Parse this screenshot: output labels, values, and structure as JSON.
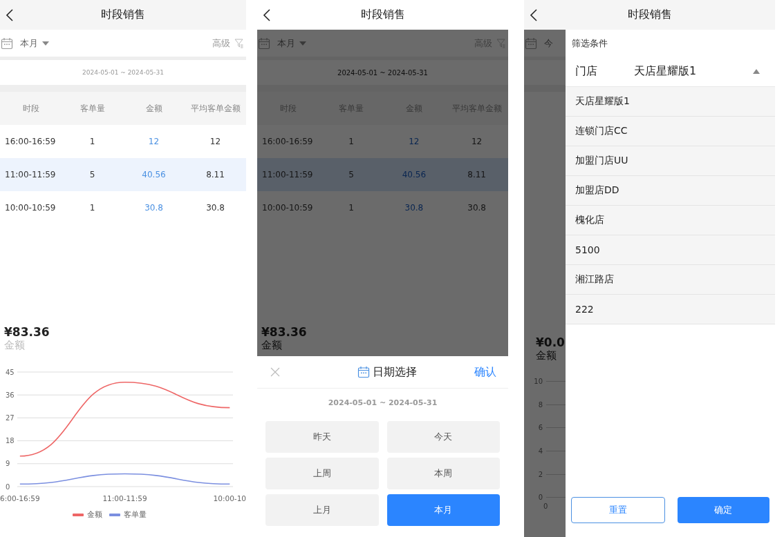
{
  "screens": [
    {
      "kind": "report",
      "title": "时段销售",
      "period": "本月",
      "advanced": "高级",
      "date_range": "2024-05-01 ~ 2024-05-31",
      "table": {
        "columns": [
          "时段",
          "客单量",
          "金额",
          "平均客单金额"
        ],
        "rows": [
          {
            "cells": [
              "16:00-16:59",
              "1",
              "12",
              "12"
            ],
            "selected": false
          },
          {
            "cells": [
              "11:00-11:59",
              "5",
              "40.56",
              "8.11"
            ],
            "selected": true
          },
          {
            "cells": [
              "10:00-10:59",
              "1",
              "30.8",
              "30.8"
            ],
            "selected": false
          }
        ]
      },
      "summary": {
        "value": "¥83.36",
        "label": "金额"
      },
      "chart_data": {
        "type": "line",
        "categories": [
          "6:00-16:59",
          "11:00-11:59",
          "10:00-10"
        ],
        "ylim": [
          0,
          45
        ],
        "yticks": [
          0,
          9,
          18,
          27,
          36,
          45
        ],
        "grid": true,
        "legend": true,
        "series": [
          {
            "name": "金额",
            "color": "#ee6666",
            "values": [
              12,
              41,
              31
            ]
          },
          {
            "name": "客单量",
            "color": "#7b8fe0",
            "values": [
              1,
              5,
              1
            ]
          }
        ]
      }
    },
    {
      "kind": "date_sheet",
      "title": "时段销售",
      "period": "本月",
      "advanced": "高级",
      "date_range": "2024-05-01 ~ 2024-05-31",
      "table": {
        "columns": [
          "时段",
          "客单量",
          "金额",
          "平均客单金额"
        ],
        "rows": [
          {
            "cells": [
              "16:00-16:59",
              "1",
              "12",
              "12"
            ],
            "selected": false
          },
          {
            "cells": [
              "11:00-11:59",
              "5",
              "40.56",
              "8.11"
            ],
            "selected": true
          },
          {
            "cells": [
              "10:00-10:59",
              "1",
              "30.8",
              "30.8"
            ],
            "selected": false
          }
        ]
      },
      "summary": {
        "value": "¥83.36",
        "label": "金额"
      },
      "sheet": {
        "title": "日期选择",
        "confirm": "确认",
        "date_range": "2024-05-01 ~ 2024-05-31",
        "options": [
          {
            "label": "昨天",
            "selected": false
          },
          {
            "label": "今天",
            "selected": false
          },
          {
            "label": "上周",
            "selected": false
          },
          {
            "label": "本周",
            "selected": false
          },
          {
            "label": "上月",
            "selected": false
          },
          {
            "label": "本月",
            "selected": true
          }
        ]
      }
    },
    {
      "kind": "filter_drawer",
      "title": "时段销售",
      "period": "今",
      "summary": {
        "value": "¥0.0",
        "label": "金额"
      },
      "y_ticks": [
        "10",
        "8",
        "6",
        "4",
        "2",
        "0"
      ],
      "x_tick": "0",
      "drawer": {
        "heading": "筛选条件",
        "field_label": "门店",
        "field_value": "天店星耀版1",
        "expanded": true,
        "options": [
          "天店星耀版1",
          "连锁门店CC",
          "加盟门店UU",
          "加盟店DD",
          "槐化店",
          "5100",
          "湘江路店",
          "222"
        ],
        "reset": "重置",
        "ok": "确定"
      }
    }
  ]
}
